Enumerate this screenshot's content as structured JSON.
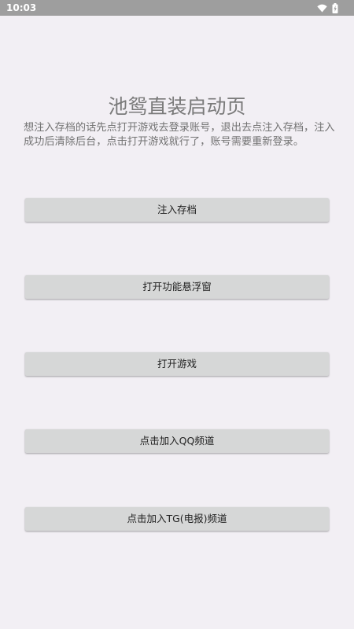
{
  "status_bar": {
    "time": "10:03",
    "icons": [
      "wifi-icon",
      "battery-icon"
    ]
  },
  "page": {
    "title": "池鸳直装启动页",
    "description": "想注入存档的话先点打开游戏去登录账号，退出去点注入存档，注入成功后清除后台，点击打开游戏就行了，账号需要重新登录。"
  },
  "buttons": {
    "inject_save": "注入存档",
    "open_floating_window": "打开功能悬浮窗",
    "open_game": "打开游戏",
    "join_qq": "点击加入QQ频道",
    "join_tg": "点击加入TG(电报)频道"
  },
  "colors": {
    "background": "#f2eff4",
    "status_bar": "#9e9e9e",
    "button_bg": "#d6d7d7",
    "title_text": "#7a7a7a"
  }
}
